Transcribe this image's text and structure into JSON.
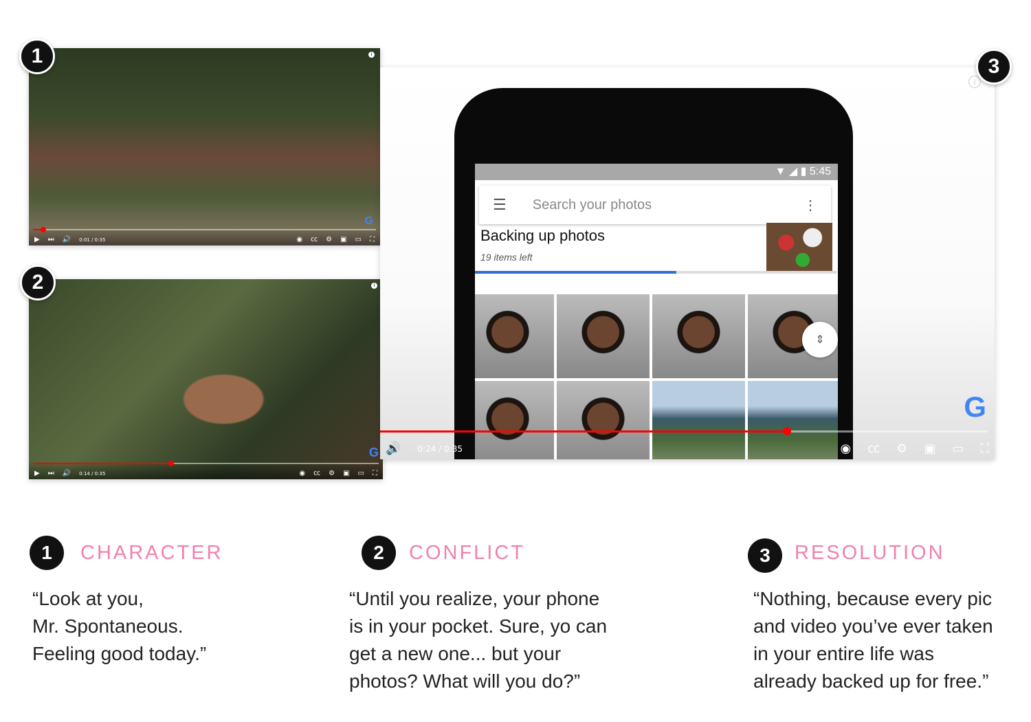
{
  "videos": [
    {
      "time": "0:01 / 0:35",
      "progress": 0.03
    },
    {
      "time": "0:14 / 0:35",
      "progress": 0.4
    },
    {
      "time": "0:24 / 0:35",
      "progress": 0.67
    }
  ],
  "phone": {
    "clock": "5:45",
    "search_placeholder": "Search your photos",
    "backup_title": "Backing up photos",
    "backup_subtitle": "19 items left",
    "backup_progress": 0.56
  },
  "icons": [
    "play-icon",
    "next-icon",
    "volume-icon",
    "autoplay-toggle",
    "cc-icon",
    "gear-icon",
    "miniplayer-icon",
    "theater-icon",
    "fullscreen-icon",
    "google-logo",
    "info-icon",
    "menu-icon",
    "more-vert-icon"
  ],
  "accent": "#f27fae",
  "steps": [
    {
      "num": "1",
      "title": "CHARACTER",
      "quote": "“Look at you,\nMr. Spontaneous.\nFeeling good today.”"
    },
    {
      "num": "2",
      "title": "CONFLICT",
      "quote": "“Until you realize, your phone\nis in your pocket. Sure, yo can\nget a new one... but your\nphotos? What will you do?”"
    },
    {
      "num": "3",
      "title": "RESOLUTION",
      "quote": "“Nothing, because every pic\nand video you’ve ever taken\nin your entire life was\nalready backed up for free.”"
    }
  ]
}
